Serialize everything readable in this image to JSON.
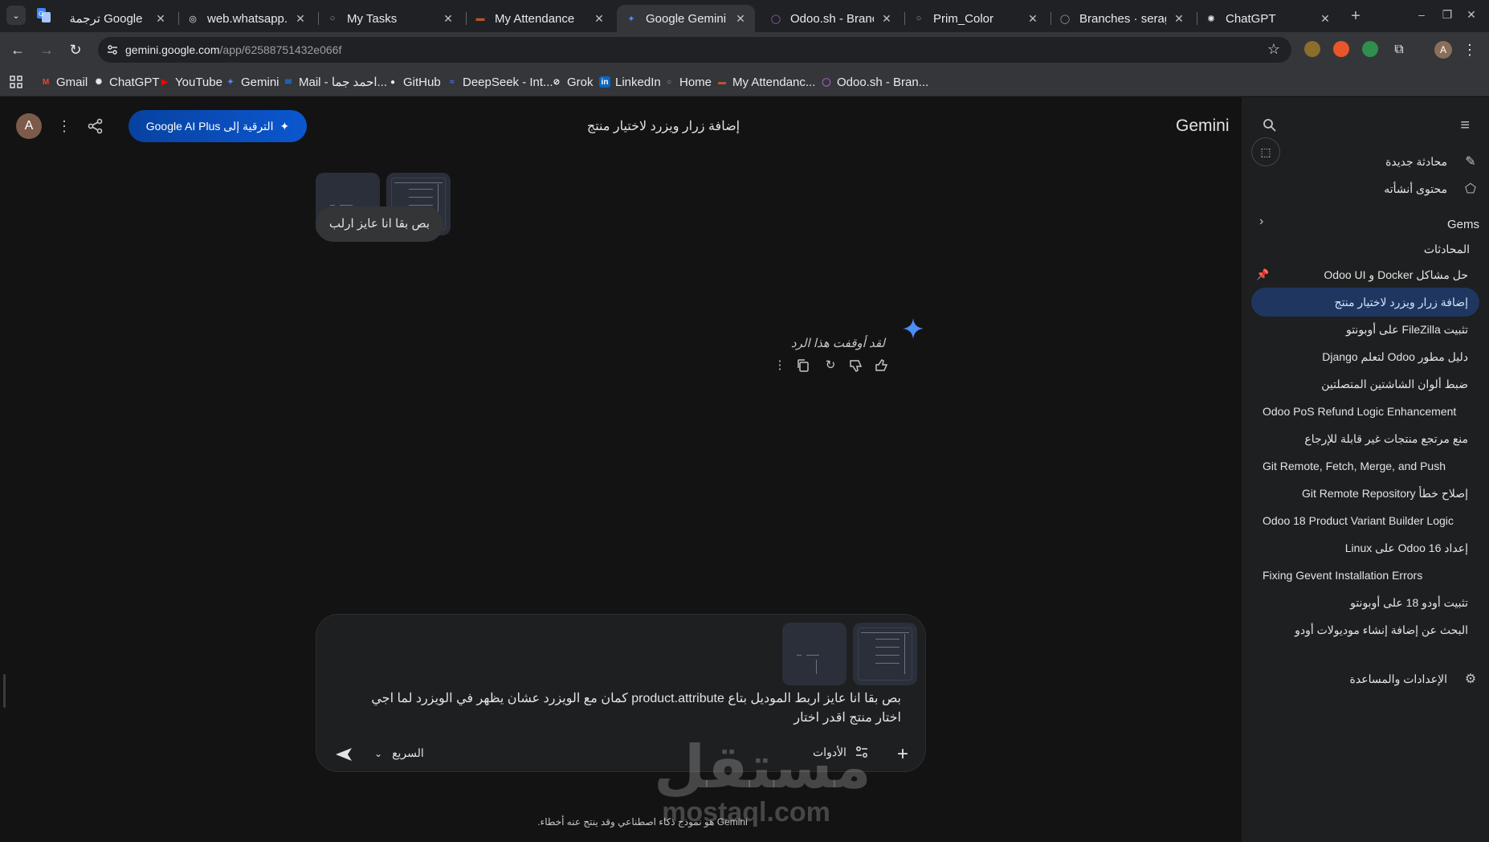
{
  "browser": {
    "tabs": [
      {
        "title": "Google ترجمة",
        "icon": "google-translate-icon",
        "active": false
      },
      {
        "title": "web.whatsapp.c",
        "icon": "globe-icon",
        "active": false
      },
      {
        "title": "My Tasks",
        "icon": "circle-icon",
        "active": false
      },
      {
        "title": "My Attendance",
        "icon": "attendance-icon",
        "active": false
      },
      {
        "title": "Google Gemini",
        "icon": "gemini-icon",
        "active": true
      },
      {
        "title": "Odoo.sh - Branc",
        "icon": "odoo-icon",
        "active": false
      },
      {
        "title": "Prim_Color",
        "icon": "circle-icon",
        "active": false
      },
      {
        "title": "Branches · serag",
        "icon": "github-icon",
        "active": false
      },
      {
        "title": "ChatGPT",
        "icon": "chatgpt-icon",
        "active": false
      }
    ],
    "url_host": "gemini.google.com",
    "url_path": "/app/62588751432e066f",
    "profile_initial": "A",
    "bookmarks": [
      {
        "label": "Gmail",
        "icon": "gmail-icon",
        "color": "#ea4335"
      },
      {
        "label": "ChatGPT",
        "icon": "chatgpt-icon",
        "color": "#e8eaed"
      },
      {
        "label": "YouTube",
        "icon": "youtube-icon",
        "color": "#ff0000"
      },
      {
        "label": "Gemini",
        "icon": "gemini-icon",
        "color": "#4c8df6"
      },
      {
        "label": "Mail - احمد جما...",
        "icon": "mail-icon",
        "color": "#1a73e8"
      },
      {
        "label": "GitHub",
        "icon": "github-icon",
        "color": "#e8eaed"
      },
      {
        "label": "DeepSeek - Int...",
        "icon": "deepseek-icon",
        "color": "#4d6bfe"
      },
      {
        "label": "Grok",
        "icon": "grok-icon",
        "color": "#e8eaed"
      },
      {
        "label": "LinkedIn",
        "icon": "linkedin-icon",
        "color": "#0a66c2"
      },
      {
        "label": "Home",
        "icon": "circle-icon",
        "color": "#9aa0a6"
      },
      {
        "label": "My Attendanc...",
        "icon": "attendance-icon",
        "color": "#b5542c"
      },
      {
        "label": "Odoo.sh - Bran...",
        "icon": "odoo-icon",
        "color": "#a45fbf"
      }
    ]
  },
  "gemini": {
    "logo": "Gemini",
    "chat_title": "إضافة زرار ويزرد لاختيار منتج",
    "upgrade_label": "الترقية إلى Google AI Plus",
    "user_initial": "A",
    "user_message": "بص بقا انا عايز ارلب",
    "stopped_text": "لقد أوقفت هذا الرد",
    "composer_text": "بص بقا انا عايز اربط الموديل بتاع product.attribute كمان مع الويزرد عشان يظهر في الويزرد لما اجي اختار منتج اقدر اختار",
    "model_label": "السريع",
    "tools_label": "الأدوات",
    "disclaimer": "Gemini هو نموذج ذكاء اصطناعي وقد ينتج عنه أخطاء.",
    "accent_color": "#0b57d0"
  },
  "sidebar": {
    "new_chat": "محادثة جديدة",
    "my_content": "محتوى أنشأته",
    "gems": "Gems",
    "conversations_label": "المحادثات",
    "conversations": [
      {
        "title": "حل مشاكل Docker و Odoo UI",
        "pinned": true,
        "active": false,
        "ltr": false
      },
      {
        "title": "إضافة زرار ويزرد لاختيار منتج",
        "pinned": false,
        "active": true,
        "ltr": false
      },
      {
        "title": "تثبيت FileZilla على أوبونتو",
        "pinned": false,
        "active": false,
        "ltr": false
      },
      {
        "title": "دليل مطور Odoo لتعلم Django",
        "pinned": false,
        "active": false,
        "ltr": false
      },
      {
        "title": "ضبط ألوان الشاشتين المتصلتين",
        "pinned": false,
        "active": false,
        "ltr": false
      },
      {
        "title": "Odoo PoS Refund Logic Enhancement",
        "pinned": false,
        "active": false,
        "ltr": true
      },
      {
        "title": "منع مرتجع منتجات غير قابلة للإرجاع",
        "pinned": false,
        "active": false,
        "ltr": false
      },
      {
        "title": "Git Remote, Fetch, Merge, and Push",
        "pinned": false,
        "active": false,
        "ltr": true
      },
      {
        "title": "إصلاح خطأ Git Remote Repository",
        "pinned": false,
        "active": false,
        "ltr": false
      },
      {
        "title": "Odoo 18 Product Variant Builder Logic",
        "pinned": false,
        "active": false,
        "ltr": true
      },
      {
        "title": "إعداد Odoo 16 على Linux",
        "pinned": false,
        "active": false,
        "ltr": false
      },
      {
        "title": "Fixing Gevent Installation Errors",
        "pinned": false,
        "active": false,
        "ltr": true
      },
      {
        "title": "تثبيت أودو 18 على أوبونتو",
        "pinned": false,
        "active": false,
        "ltr": false
      },
      {
        "title": "البحث عن إضافة إنشاء موديولات أودو",
        "pinned": false,
        "active": false,
        "ltr": false
      }
    ],
    "settings": "الإعدادات والمساعدة"
  },
  "watermark": {
    "arabic": "مستقل",
    "latin": "mostaql.com"
  }
}
